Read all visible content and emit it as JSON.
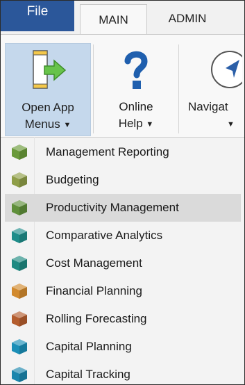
{
  "tabs": {
    "file": "File",
    "main": "MAIN",
    "admin": "ADMIN"
  },
  "ribbon": {
    "open_app_menus": {
      "line1": "Open App",
      "line2": "Menus"
    },
    "online_help": {
      "line1": "Online",
      "line2": "Help"
    },
    "navigate": {
      "line1": "Navigat"
    }
  },
  "menu": {
    "items": [
      {
        "label": "Management Reporting",
        "color": "#6a9a3a"
      },
      {
        "label": "Budgeting",
        "color": "#8f9e48"
      },
      {
        "label": "Productivity Management",
        "color": "#5f8f3a"
      },
      {
        "label": "Comparative Analytics",
        "color": "#1f8d8a"
      },
      {
        "label": "Cost Management",
        "color": "#1f8a82"
      },
      {
        "label": "Financial Planning",
        "color": "#d28a2e"
      },
      {
        "label": "Rolling Forecasting",
        "color": "#b45d2e"
      },
      {
        "label": "Capital Planning",
        "color": "#1b8fb7"
      },
      {
        "label": "Capital Tracking",
        "color": "#1b86ad"
      }
    ],
    "highlighted": "Productivity Management"
  },
  "colors": {
    "file_tab": "#2b579a",
    "hover": "#dadada",
    "pressed": "#c5d8ec"
  }
}
